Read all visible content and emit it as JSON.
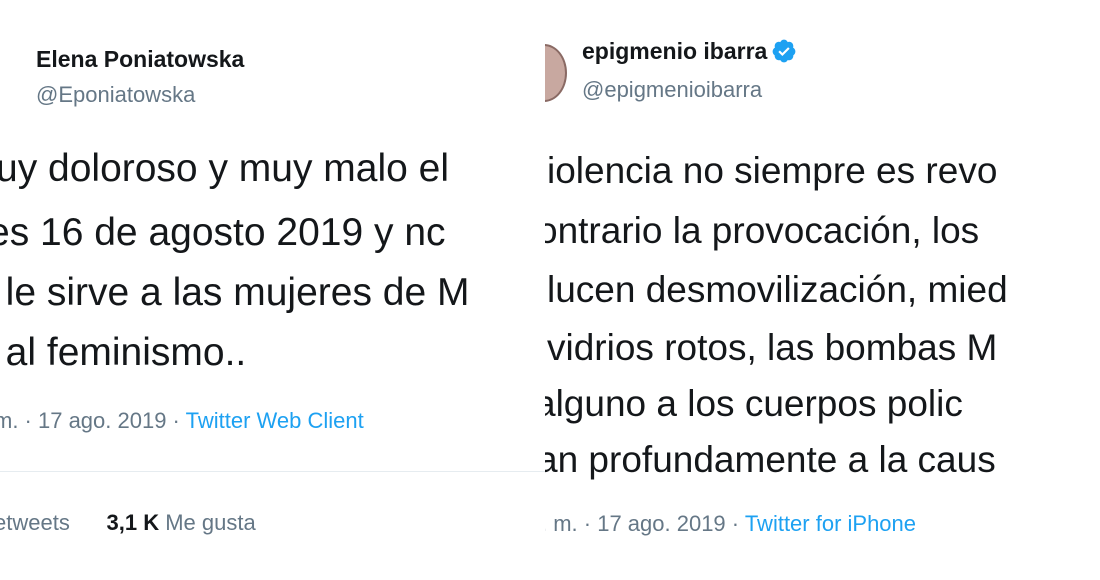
{
  "left_tweet": {
    "display_name": "Elena Poniatowska",
    "handle": "@Eponiatowska",
    "lines": [
      "uy doloroso y muy malo el",
      "es 16 de agosto 2019 y nc",
      ". le sirve a las mujeres de M",
      ". al feminismo.."
    ],
    "meta_time": "m. · 17 ago. 2019 · ",
    "meta_client": "Twitter Web Client",
    "retweets_label": "etweets",
    "likes_count": "3,1 K",
    "likes_label": "Me gusta"
  },
  "right_tweet": {
    "display_name": "epigmenio ibarra",
    "verified_icon": "verified-badge-icon",
    "handle": "@epigmenioibarra",
    "lines": [
      "iolencia no siempre es revo",
      "ontrario la provocación, los",
      "lucen desmovilización, mied",
      "vidrios rotos, las bombas M",
      "alguno a los cuerpos polic",
      "an profundamente a la caus"
    ],
    "meta_time": ". m. · 17 ago. 2019 · ",
    "meta_client": "Twitter for iPhone"
  },
  "colors": {
    "text": "#14171a",
    "secondary": "#657786",
    "link": "#1da1f2",
    "divider": "#e6ecf0"
  }
}
